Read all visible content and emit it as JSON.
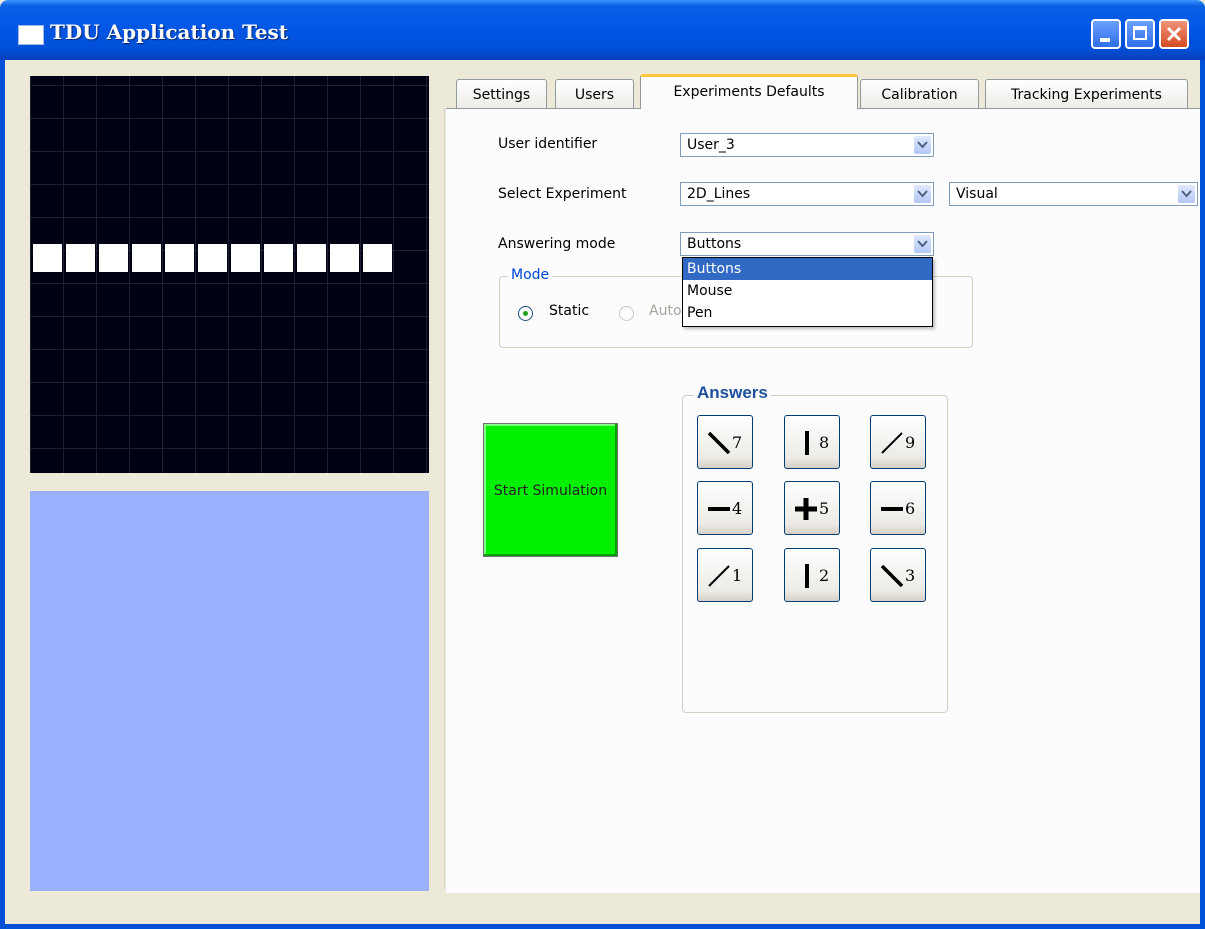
{
  "window": {
    "title": "TDU Application Test"
  },
  "tabs": [
    {
      "label": "Settings"
    },
    {
      "label": "Users"
    },
    {
      "label": "Experiments Defaults"
    },
    {
      "label": "Calibration"
    },
    {
      "label": "Tracking Experiments"
    }
  ],
  "active_tab": "Experiments Defaults",
  "form": {
    "user_identifier_label": "User identifier",
    "user_identifier_value": "User_3",
    "select_experiment_label": "Select Experiment",
    "select_experiment_value": "2D_Lines",
    "experiment_type_value": "Visual",
    "answering_mode_label": "Answering mode",
    "answering_mode_value": "Buttons",
    "answering_mode_options": [
      "Buttons",
      "Mouse",
      "Pen"
    ]
  },
  "mode_group": {
    "title": "Mode",
    "static_label": "Static",
    "auto_label_visible": "Auto"
  },
  "start_button_label": "Start Simulation",
  "answers": {
    "title": "Answers",
    "buttons": [
      {
        "num": "7",
        "glyph": "backslash-line-icon"
      },
      {
        "num": "8",
        "glyph": "vertical-line-icon"
      },
      {
        "num": "9",
        "glyph": "slash-line-icon"
      },
      {
        "num": "4",
        "glyph": "horizontal-line-icon"
      },
      {
        "num": "5",
        "glyph": "plus-icon"
      },
      {
        "num": "6",
        "glyph": "horizontal-line-icon"
      },
      {
        "num": "1",
        "glyph": "slash-line-icon"
      },
      {
        "num": "2",
        "glyph": "vertical-line-icon"
      },
      {
        "num": "3",
        "glyph": "backslash-line-icon"
      }
    ]
  },
  "colors": {
    "titlebar": "#0058E6",
    "grid_background": "#000014",
    "lit_cells": "#FFFFFF",
    "lower_panel": "#9BB3FF",
    "start_button": "#00F000",
    "group_title": "#0046D5",
    "dropdown_selection": "#316AC5"
  },
  "display": {
    "lit_row_cell_count": 11
  }
}
